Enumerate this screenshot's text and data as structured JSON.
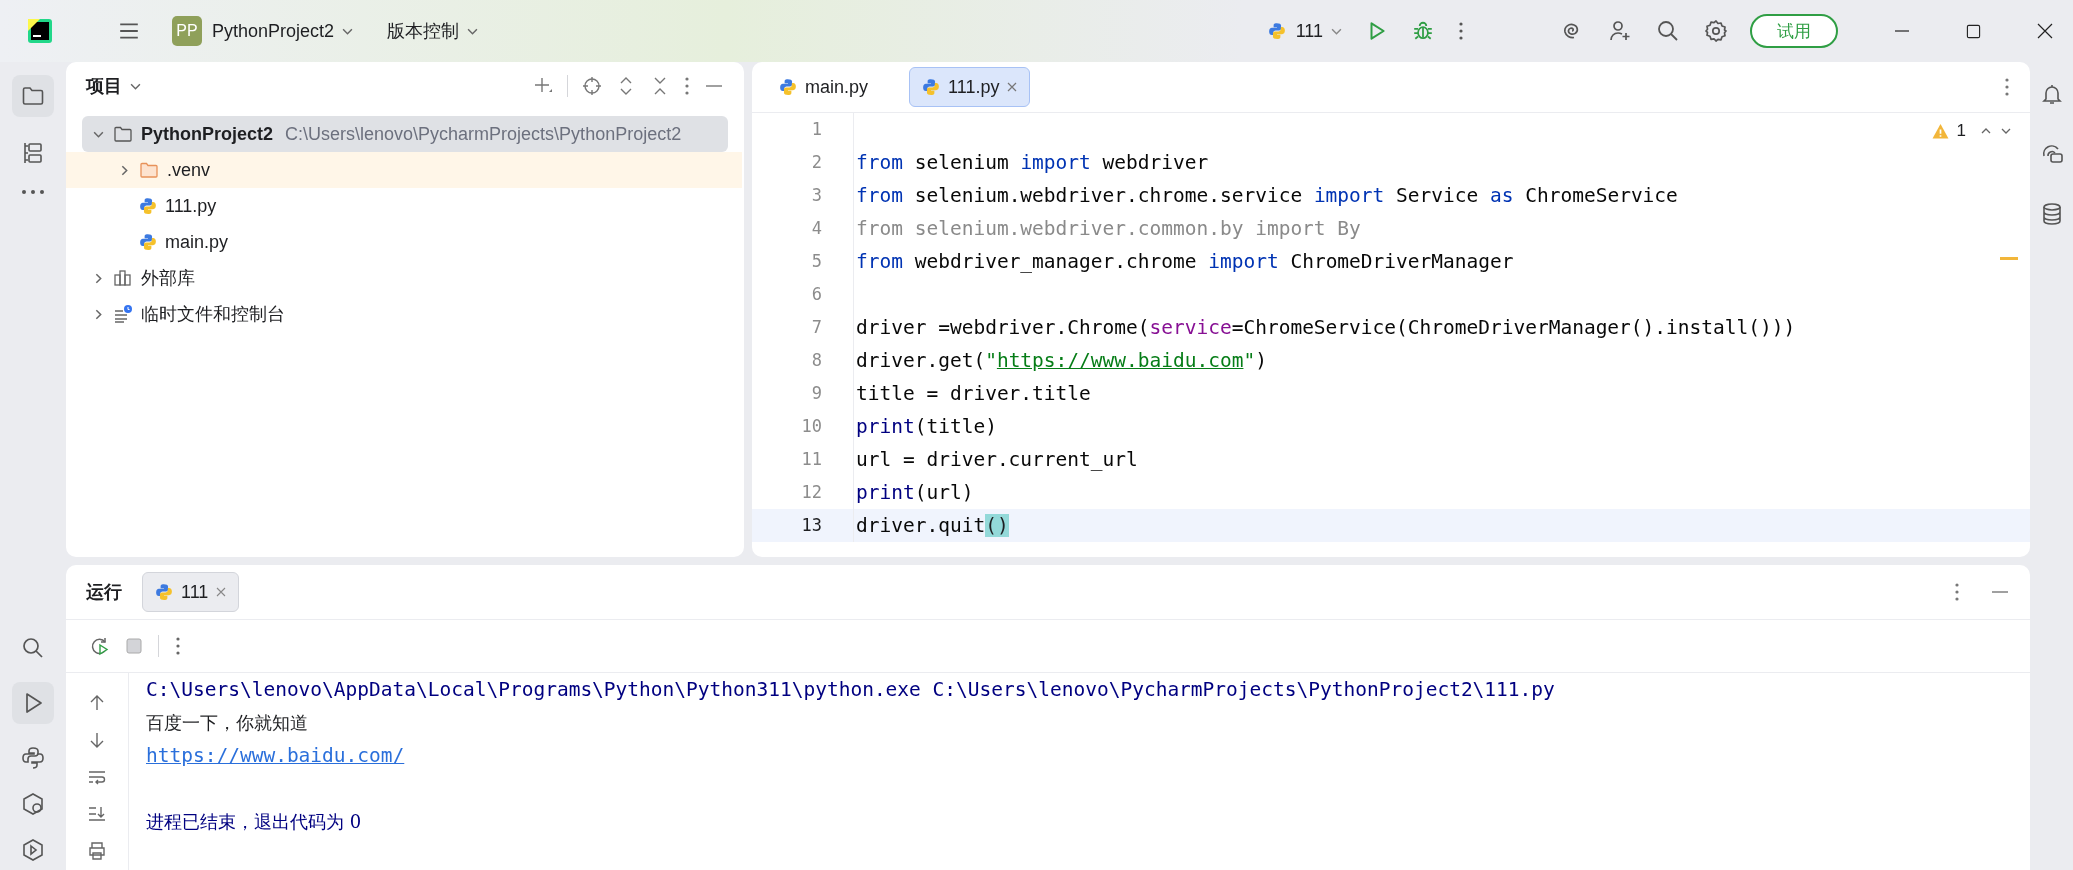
{
  "title_bar": {
    "project_badge": "PP",
    "project": "PythonProject2",
    "vcs": "版本控制",
    "run_config": "111",
    "trial_button": "试用"
  },
  "project_panel": {
    "title": "项目",
    "tree": [
      {
        "label": "PythonProject2",
        "path": "C:\\Users\\lenovo\\PycharmProjects\\PythonProject2",
        "kind": "project",
        "expanded": true,
        "selected": true,
        "highlighted": false,
        "children": [
          {
            "label": ".venv",
            "kind": "folder",
            "expanded": false,
            "selected": false,
            "highlighted": true
          },
          {
            "label": "111.py",
            "kind": "python",
            "selected": false,
            "highlighted": false
          },
          {
            "label": "main.py",
            "kind": "python",
            "selected": false,
            "highlighted": false
          }
        ]
      },
      {
        "label": "外部库",
        "kind": "library",
        "expanded": false,
        "selected": false,
        "highlighted": false
      },
      {
        "label": "临时文件和控制台",
        "kind": "scratches",
        "expanded": false,
        "selected": false,
        "highlighted": false
      }
    ]
  },
  "editor": {
    "tabs": [
      {
        "label": "main.py",
        "selected": false
      },
      {
        "label": "111.py",
        "selected": true
      }
    ],
    "warnings": "1",
    "lines": [
      {
        "number": "1",
        "current": false
      },
      {
        "number": "2",
        "current": false,
        "tokens": [
          {
            "text": "from",
            "kind": "keyword"
          },
          {
            "text": " selenium ",
            "kind": "plain"
          },
          {
            "text": "import",
            "kind": "keyword"
          },
          {
            "text": " webdriver",
            "kind": "plain"
          }
        ]
      },
      {
        "number": "3",
        "current": false,
        "tokens": [
          {
            "text": "from",
            "kind": "keyword"
          },
          {
            "text": " selenium.webdriver.chrome.service ",
            "kind": "plain"
          },
          {
            "text": "import",
            "kind": "keyword"
          },
          {
            "text": " Service ",
            "kind": "plain"
          },
          {
            "text": "as",
            "kind": "keyword"
          },
          {
            "text": " ChromeService",
            "kind": "plain"
          }
        ]
      },
      {
        "number": "4",
        "current": false,
        "tokens": [
          {
            "text": "from selenium.webdriver.common.by import By",
            "kind": "unused"
          }
        ]
      },
      {
        "number": "5",
        "current": false,
        "tokens": [
          {
            "text": "from",
            "kind": "keyword"
          },
          {
            "text": " webdriver_manager.chrome ",
            "kind": "plain"
          },
          {
            "text": "import",
            "kind": "keyword"
          },
          {
            "text": " ChromeDriverManager",
            "kind": "plain"
          }
        ]
      },
      {
        "number": "6",
        "current": false
      },
      {
        "number": "7",
        "current": false,
        "tokens": [
          {
            "text": "driver =webdriver.Chrome(",
            "kind": "plain"
          },
          {
            "text": "service",
            "kind": "param"
          },
          {
            "text": "=ChromeService(ChromeDriverManager().install()))",
            "kind": "plain"
          }
        ]
      },
      {
        "number": "8",
        "current": false,
        "tokens": [
          {
            "text": "driver.get(",
            "kind": "plain"
          },
          {
            "text": "\"",
            "kind": "string"
          },
          {
            "text": "https://www.baidu.com",
            "kind": "link"
          },
          {
            "text": "\"",
            "kind": "string"
          },
          {
            "text": ")",
            "kind": "plain"
          }
        ]
      },
      {
        "number": "9",
        "current": false,
        "tokens": [
          {
            "text": "title = driver.title",
            "kind": "plain"
          }
        ]
      },
      {
        "number": "10",
        "current": false,
        "tokens": [
          {
            "text": "print",
            "kind": "builtin"
          },
          {
            "text": "(title)",
            "kind": "plain"
          }
        ]
      },
      {
        "number": "11",
        "current": false,
        "tokens": [
          {
            "text": "url = driver.current_url",
            "kind": "plain"
          }
        ]
      },
      {
        "number": "12",
        "current": false,
        "tokens": [
          {
            "text": "print",
            "kind": "builtin"
          },
          {
            "text": "(url)",
            "kind": "plain"
          }
        ]
      },
      {
        "number": "13",
        "current": true,
        "tokens": [
          {
            "text": "driver.quit",
            "kind": "plain"
          },
          {
            "text": "()",
            "kind": "match"
          }
        ]
      }
    ]
  },
  "run_panel": {
    "title": "运行",
    "tabs": [
      {
        "label": "111",
        "selected": true
      }
    ],
    "console": [
      {
        "kind": "command",
        "text": "C:\\Users\\lenovo\\AppData\\Local\\Programs\\Python\\Python311\\python.exe C:\\Users\\lenovo\\PycharmProjects\\PythonProject2\\111.py"
      },
      {
        "kind": "output",
        "text": "百度一下，你就知道"
      },
      {
        "kind": "link",
        "text": "https://www.baidu.com/"
      },
      {
        "kind": "exit",
        "text": "进程已结束，退出代码为 0"
      }
    ]
  }
}
